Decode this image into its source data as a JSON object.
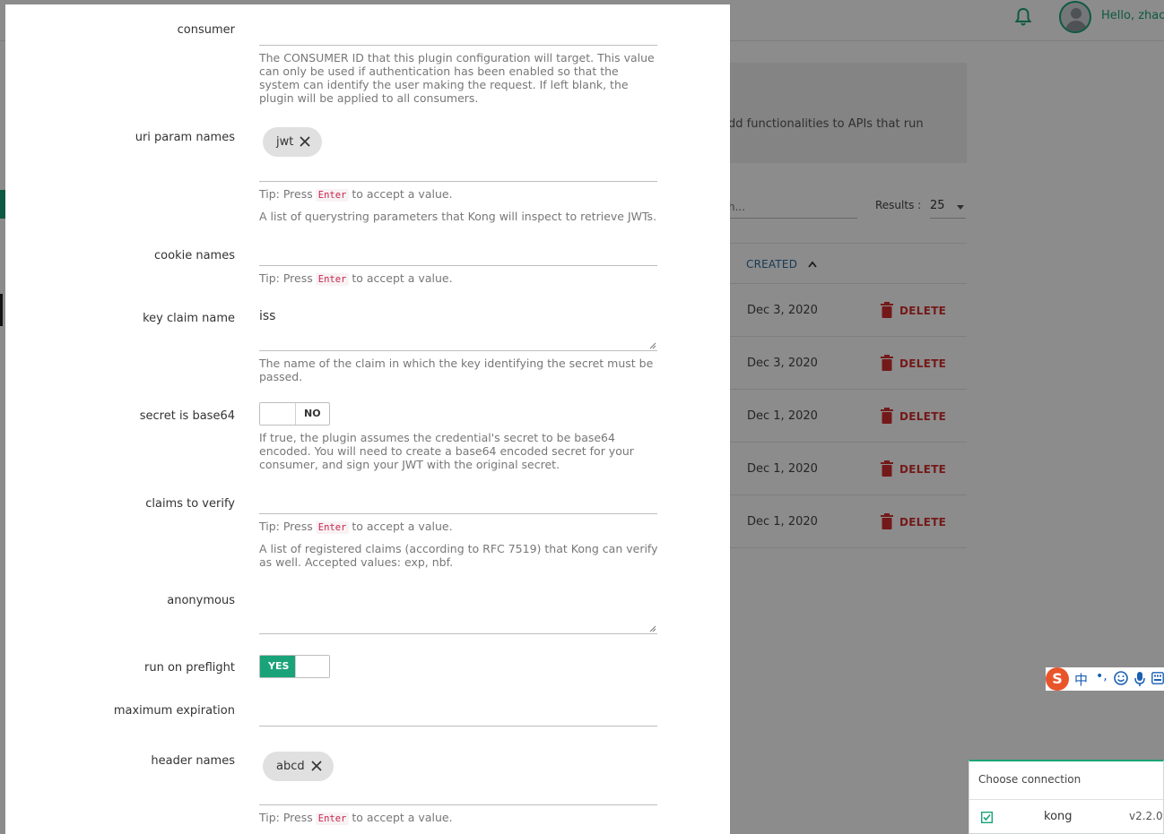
{
  "background": {
    "user_greeting": "Hello, zhaos",
    "banner_text": "dd functionalities to APIs that run",
    "search_placeholder": "h...",
    "results_label": "Results :",
    "results_value": "25",
    "column_created": "CREATED",
    "rows": [
      {
        "created": "Dec 3, 2020",
        "action": "DELETE"
      },
      {
        "created": "Dec 3, 2020",
        "action": "DELETE"
      },
      {
        "created": "Dec 1, 2020",
        "action": "DELETE"
      },
      {
        "created": "Dec 1, 2020",
        "action": "DELETE"
      },
      {
        "created": "Dec 1, 2020",
        "action": "DELETE"
      }
    ],
    "ime": {
      "logo": "S",
      "mode": "中",
      "punct": "•,"
    },
    "connection": {
      "title": "Choose connection",
      "name": "kong",
      "version": "v2.2.0"
    }
  },
  "modal": {
    "tip_prefix": "Tip: Press",
    "tip_key": "Enter",
    "tip_suffix": "to accept a value.",
    "fields": {
      "consumer": {
        "label": "consumer",
        "value": "",
        "help": "The CONSUMER ID that this plugin configuration will target. This value can only be used if authentication has been enabled so that the system can identify the user making the request. If left blank, the plugin will be applied to all consumers."
      },
      "uri_param_names": {
        "label": "uri param names",
        "chips": [
          "jwt"
        ],
        "help": "A list of querystring parameters that Kong will inspect to retrieve JWTs."
      },
      "cookie_names": {
        "label": "cookie names",
        "chips": []
      },
      "key_claim_name": {
        "label": "key claim name",
        "value": "iss",
        "help": "The name of the claim in which the key identifying the secret must be passed."
      },
      "secret_is_base64": {
        "label": "secret is base64",
        "state": "NO",
        "help": "If true, the plugin assumes the credential's secret to be base64 encoded. You will need to create a base64 encoded secret for your consumer, and sign your JWT with the original secret."
      },
      "claims_to_verify": {
        "label": "claims to verify",
        "chips": [],
        "help": "A list of registered claims (according to RFC 7519) that Kong can verify as well. Accepted values: exp, nbf."
      },
      "anonymous": {
        "label": "anonymous",
        "value": ""
      },
      "run_on_preflight": {
        "label": "run on preflight",
        "state": "YES"
      },
      "maximum_expiration": {
        "label": "maximum expiration",
        "value": ""
      },
      "header_names": {
        "label": "header names",
        "chips": [
          "abcd"
        ]
      }
    }
  },
  "colors": {
    "accent": "#1aa378",
    "danger": "#d32f2f",
    "link": "#2a6aa0"
  }
}
